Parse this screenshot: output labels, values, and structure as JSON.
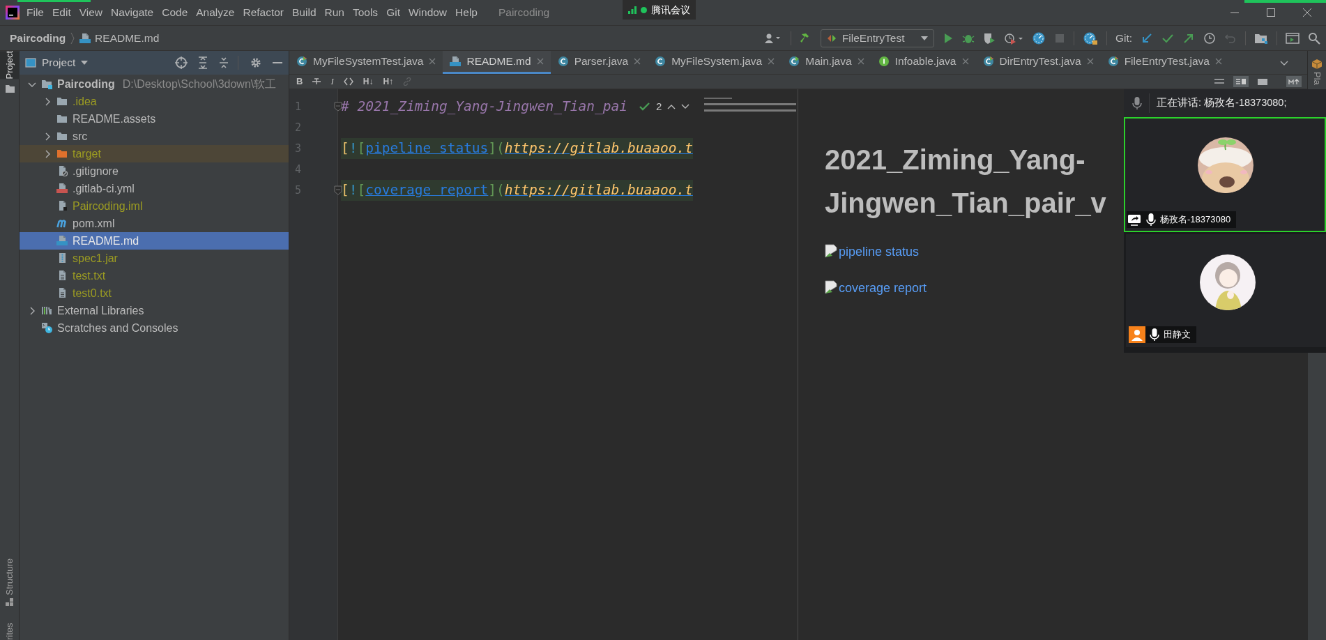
{
  "title_bar": {
    "menu": [
      "File",
      "Edit",
      "View",
      "Navigate",
      "Code",
      "Analyze",
      "Refactor",
      "Build",
      "Run",
      "Tools",
      "Git",
      "Window",
      "Help"
    ],
    "title": "Paircoding"
  },
  "meeting_badge": {
    "label": "腾讯会议"
  },
  "nav_bar": {
    "breadcrumb": [
      {
        "label": "Paircoding",
        "kind": "project"
      },
      {
        "label": "README.md",
        "kind": "md"
      }
    ],
    "run_config": "FileEntryTest",
    "git_label": "Git:"
  },
  "tool_strips": {
    "left": [
      {
        "label": "Project",
        "selected": true
      },
      {
        "label": "Structure",
        "selected": false
      },
      {
        "label": "rites",
        "selected": false
      }
    ],
    "right": [
      {
        "label": "Pla",
        "selected": false
      }
    ]
  },
  "project_panel": {
    "title": "Project",
    "tree": [
      {
        "label": "Paircoding",
        "path": "D:\\Desktop\\School\\3down\\软工",
        "kind": "module",
        "expanded": true,
        "selected": false,
        "ignored": false,
        "children": [
          {
            "label": ".idea",
            "kind": "folder",
            "expanded": false,
            "selected": false,
            "ignored": true
          },
          {
            "label": "README.assets",
            "kind": "folder",
            "selected": false,
            "ignored": false
          },
          {
            "label": "src",
            "kind": "folder",
            "expanded": false,
            "selected": false,
            "ignored": false
          },
          {
            "label": "target",
            "kind": "excluded-folder",
            "expanded": false,
            "selected": false,
            "ignored": true
          },
          {
            "label": ".gitignore",
            "kind": "gitignore",
            "selected": false,
            "ignored": false
          },
          {
            "label": ".gitlab-ci.yml",
            "kind": "yml",
            "selected": false,
            "ignored": false
          },
          {
            "label": "Paircoding.iml",
            "kind": "iml",
            "selected": false,
            "ignored": true
          },
          {
            "label": "pom.xml",
            "kind": "maven",
            "selected": false,
            "ignored": false
          },
          {
            "label": "README.md",
            "kind": "md",
            "selected": true,
            "ignored": false
          },
          {
            "label": "spec1.jar",
            "kind": "jar",
            "selected": false,
            "ignored": true
          },
          {
            "label": "test.txt",
            "kind": "txt",
            "selected": false,
            "ignored": true
          },
          {
            "label": "test0.txt",
            "kind": "txt",
            "selected": false,
            "ignored": true
          }
        ]
      },
      {
        "label": "External Libraries",
        "kind": "libraries",
        "expanded": false,
        "selected": false,
        "ignored": false
      },
      {
        "label": "Scratches and Consoles",
        "kind": "scratches",
        "selected": false,
        "ignored": false
      }
    ]
  },
  "editor_tabs": [
    {
      "label": "MyFileSystemTest.java",
      "kind": "test",
      "selected": false
    },
    {
      "label": "README.md",
      "kind": "md",
      "selected": true
    },
    {
      "label": "Parser.java",
      "kind": "class",
      "selected": false
    },
    {
      "label": "MyFileSystem.java",
      "kind": "class",
      "selected": false
    },
    {
      "label": "Main.java",
      "kind": "main",
      "selected": false
    },
    {
      "label": "Infoable.java",
      "kind": "interface",
      "selected": false
    },
    {
      "label": "DirEntryTest.java",
      "kind": "test",
      "selected": false
    },
    {
      "label": "FileEntryTest.java",
      "kind": "test",
      "selected": false
    }
  ],
  "markdown_toolbar": [
    {
      "kind": "bold",
      "label": "B"
    },
    {
      "kind": "strike"
    },
    {
      "kind": "italic",
      "label": "I"
    },
    {
      "kind": "code"
    },
    {
      "kind": "header",
      "label": "H↓"
    },
    {
      "kind": "header",
      "label": "H↑"
    },
    {
      "kind": "link"
    }
  ],
  "editor": {
    "inspection_count": "2",
    "lines": [
      {
        "number": "1",
        "fold": true,
        "segments": [
          {
            "kind": "heading",
            "text": "# 2021_Ziming_Yang-Jingwen_Tian_pai"
          }
        ]
      },
      {
        "number": "2",
        "fold": false
      },
      {
        "number": "3",
        "fold": false,
        "segments": [
          {
            "kind": "bracket",
            "text": "["
          },
          {
            "kind": "bang",
            "text": "!"
          },
          {
            "kind": "inner",
            "text": "["
          },
          {
            "kind": "link-text",
            "text": "pipeline status"
          },
          {
            "kind": "inner",
            "text": "]"
          },
          {
            "kind": "inner",
            "text": "("
          },
          {
            "kind": "url",
            "text": "https://gitlab.buaaoo.t"
          }
        ]
      },
      {
        "number": "4",
        "fold": false
      },
      {
        "number": "5",
        "fold": true,
        "segments": [
          {
            "kind": "bracket",
            "text": "["
          },
          {
            "kind": "bang",
            "text": "!"
          },
          {
            "kind": "inner",
            "text": "["
          },
          {
            "kind": "link-text",
            "text": "coverage report"
          },
          {
            "kind": "inner",
            "text": "]"
          },
          {
            "kind": "inner",
            "text": "("
          },
          {
            "kind": "url",
            "text": "https://gitlab.buaaoo.t"
          }
        ]
      }
    ]
  },
  "preview": {
    "heading": "2021_Ziming_Yang-Jingwen_Tian_pair_v",
    "images": [
      {
        "alt": "pipeline status"
      },
      {
        "alt": "coverage report"
      }
    ]
  },
  "meeting_overlay": {
    "speaking": "正在讲话: 杨孜名-18373080;",
    "participants": [
      {
        "name": "杨孜名-18373080",
        "kind": "sharing",
        "active": true
      },
      {
        "name": "田静文",
        "kind": "person",
        "active": false
      }
    ]
  }
}
